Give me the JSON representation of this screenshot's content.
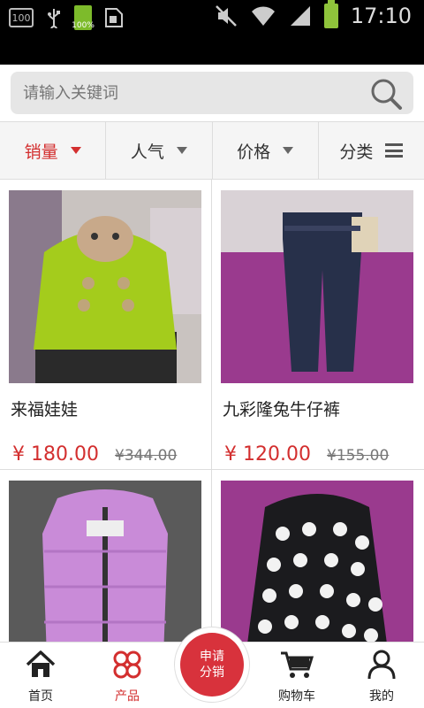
{
  "status_bar": {
    "box_text": "100",
    "battery_small_text": "100%",
    "time": "17:10"
  },
  "search": {
    "placeholder": "请输入关键词"
  },
  "filters": [
    {
      "label": "销量",
      "active": true
    },
    {
      "label": "人气",
      "active": false
    },
    {
      "label": "价格",
      "active": false
    },
    {
      "label": "分类",
      "active": false
    }
  ],
  "products": [
    {
      "name": "来福娃娃",
      "price": "¥  180.00",
      "old_price": "¥344.00"
    },
    {
      "name": "九彩隆兔牛仔裤",
      "price": "¥  120.00",
      "old_price": "¥155.00"
    },
    {
      "name": "",
      "price": "",
      "old_price": ""
    },
    {
      "name": "",
      "price": "",
      "old_price": ""
    }
  ],
  "nav": {
    "home": "首页",
    "products": "产品",
    "cta_line1": "申请",
    "cta_line2": "分销",
    "cart": "购物车",
    "mine": "我的"
  },
  "colors": {
    "accent": "#d32f2f",
    "cta": "#d8323c"
  }
}
